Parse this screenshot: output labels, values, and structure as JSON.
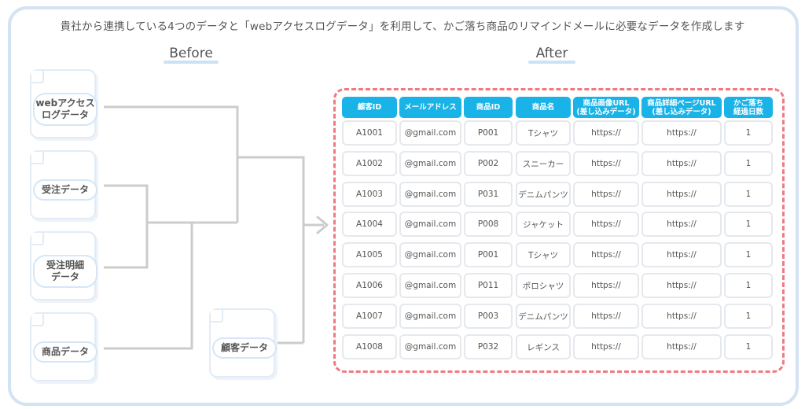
{
  "title": "貴社から連携している4つのデータと「webアクセスログデータ」を利用して、かご落ち商品のリマインドメールに必要なデータを作成します",
  "before_label": "Before",
  "after_label": "After",
  "sources": [
    {
      "label": "webアクセス\nログデータ"
    },
    {
      "label": "受注データ"
    },
    {
      "label": "受注明細\nデータ"
    },
    {
      "label": "商品データ"
    },
    {
      "label": "顧客データ"
    }
  ],
  "table": {
    "headers": [
      "顧客ID",
      "メールアドレス",
      "商品ID",
      "商品名",
      "商品画像URL\n(差し込みデータ)",
      "商品詳細ページURL\n(差し込みデータ)",
      "かご落ち\n経過日数"
    ],
    "rows": [
      [
        "A1001",
        "@gmail.com",
        "P001",
        "Tシャツ",
        "https://",
        "https://",
        "1"
      ],
      [
        "A1002",
        "@gmail.com",
        "P002",
        "スニーカー",
        "https://",
        "https://",
        "1"
      ],
      [
        "A1003",
        "@gmail.com",
        "P031",
        "デニムパンツ",
        "https://",
        "https://",
        "1"
      ],
      [
        "A1004",
        "@gmail.com",
        "P008",
        "ジャケット",
        "https://",
        "https://",
        "1"
      ],
      [
        "A1005",
        "@gmail.com",
        "P001",
        "Tシャツ",
        "https://",
        "https://",
        "1"
      ],
      [
        "A1006",
        "@gmail.com",
        "P011",
        "ポロシャツ",
        "https://",
        "https://",
        "1"
      ],
      [
        "A1007",
        "@gmail.com",
        "P003",
        "デニムパンツ",
        "https://",
        "https://",
        "1"
      ],
      [
        "A1008",
        "@gmail.com",
        "P032",
        "レギンス",
        "https://",
        "https://",
        "1"
      ]
    ]
  },
  "colors": {
    "header_bg": "#1ab3e8",
    "dashed_border": "#f07a82",
    "connector": "#cccccc",
    "frame": "#d4e3f2"
  }
}
